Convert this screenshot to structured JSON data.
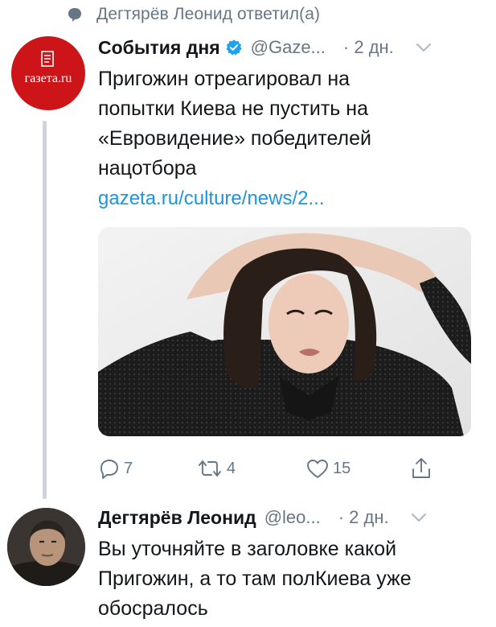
{
  "context": {
    "icon": "speech-bubble-icon",
    "text": "Дегтярёв Леонид ответил(а)"
  },
  "tweet1": {
    "avatar_text": "газета.ru",
    "name": "События дня",
    "verified": true,
    "handle": "@Gaze...",
    "time": "· 2 дн.",
    "text_lines": [
      "Пригожин отреагировал на",
      "попытки Киева не пустить на",
      "«Евровидение» победителей",
      "нацотбора"
    ],
    "link": "gazeta.ru/culture/news/2...",
    "actions": {
      "reply_count": "7",
      "retweet_count": "4",
      "like_count": "15"
    }
  },
  "tweet2": {
    "name": "Дегтярёв Леонид",
    "handle": "@leo...",
    "time": "· 2 дн.",
    "text_lines": [
      "Вы уточняйте в заголовке какой",
      "Пригожин, а то там полКиева уже",
      "обосралось"
    ]
  },
  "colors": {
    "text": "#14171a",
    "secondary": "#657786",
    "link": "#1b95e0",
    "verified": "#1da1f2",
    "thread_line": "#ccd6dd",
    "gazeta_red": "#cd1419"
  }
}
